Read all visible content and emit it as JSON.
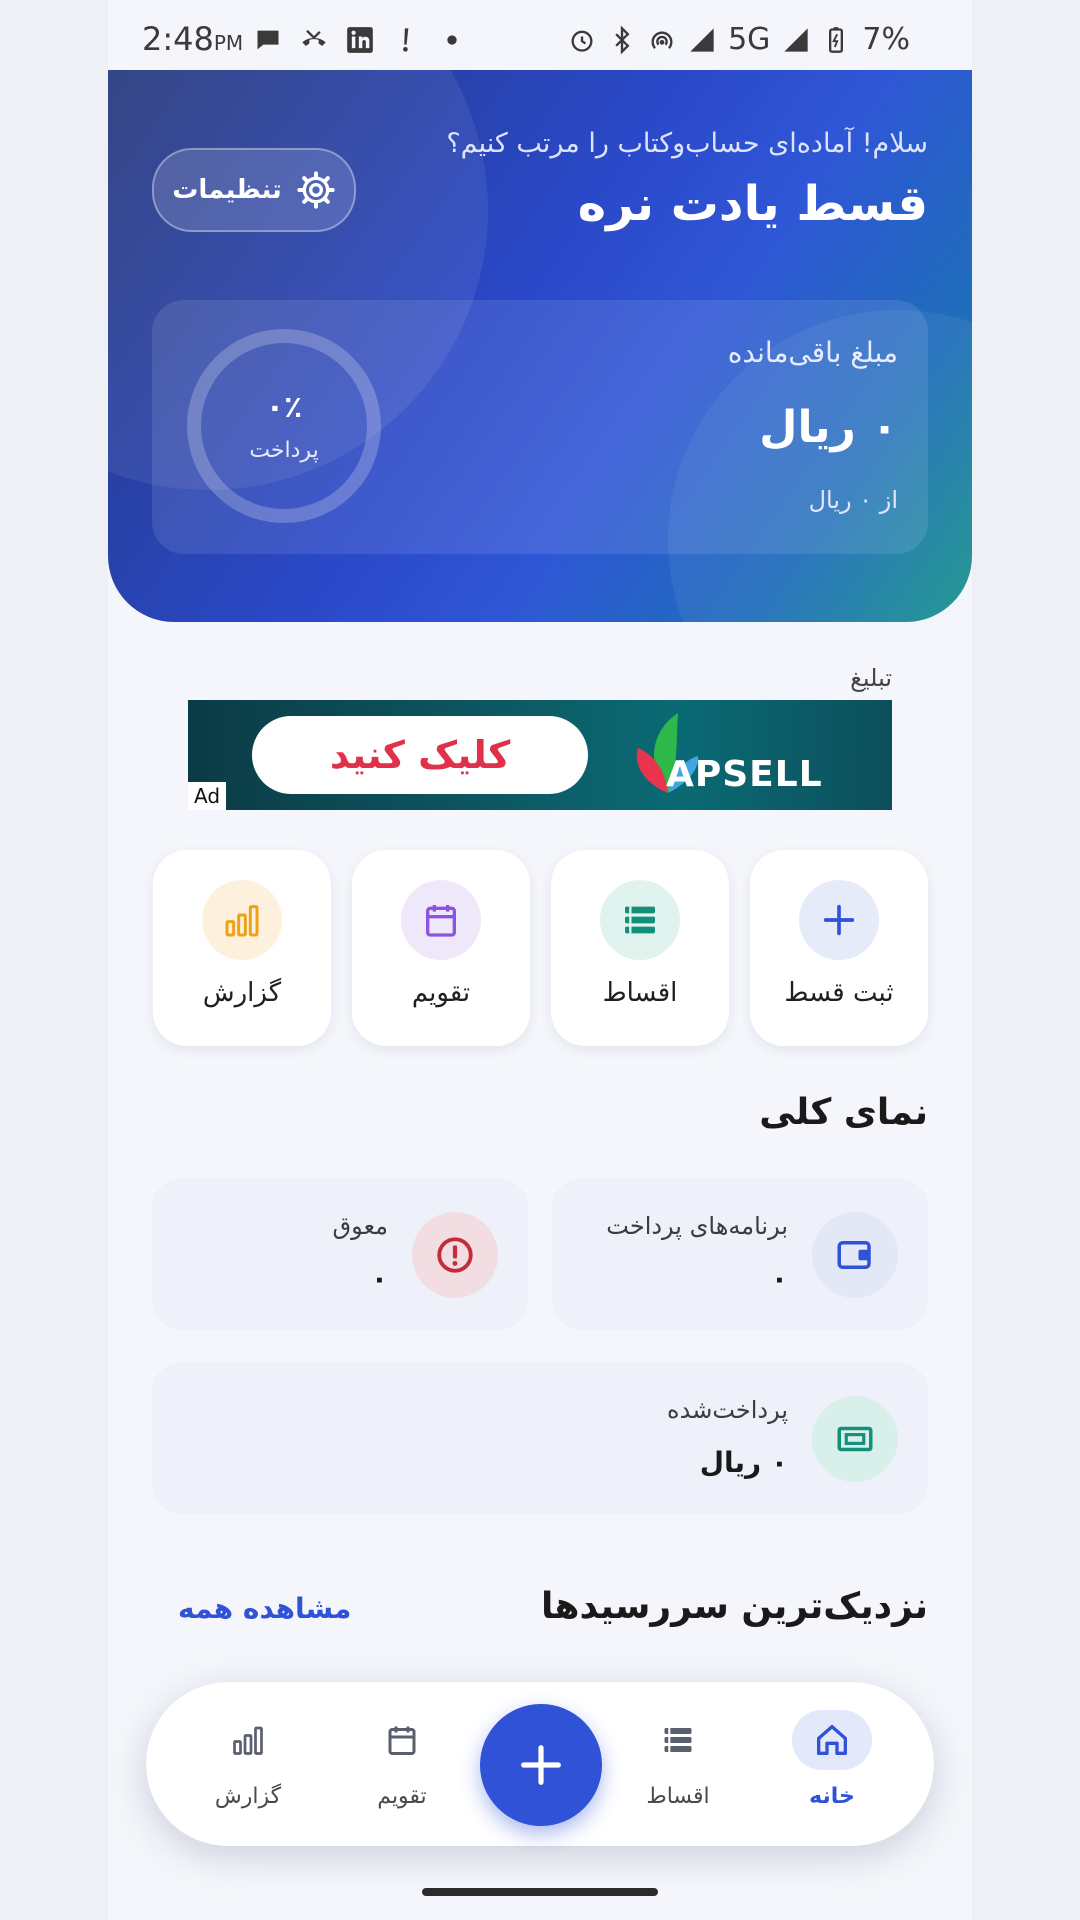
{
  "status_bar": {
    "time": "2:48",
    "ampm": "PM",
    "network": "5G",
    "battery": "7%"
  },
  "hero": {
    "greeting": "سلام! آماده‌ای حساب‌وکتاب را مرتب کنیم؟",
    "title": "قسط یادت نره",
    "settings_label": "تنظیمات",
    "balance_label": "مبلغ باقی‌مانده",
    "balance_amount": "۰ ریال",
    "balance_sub": "از ۰ ریال",
    "progress_percent": "۰٪",
    "progress_label": "پرداخت",
    "progress_value": 0
  },
  "ad": {
    "label": "تبلیغ",
    "cta": "کلیک کنید",
    "brand": "APSELL",
    "badge": "Ad"
  },
  "quick_actions": [
    {
      "label": "ثبت قسط",
      "icon": "plus-icon",
      "color": "#2f52d6",
      "bg": "#e6ebfa"
    },
    {
      "label": "اقساط",
      "icon": "list-icon",
      "color": "#14907a",
      "bg": "#e0f3ee"
    },
    {
      "label": "تقویم",
      "icon": "calendar-icon",
      "color": "#8a55e0",
      "bg": "#efe8fb"
    },
    {
      "label": "گزارش",
      "icon": "bar-chart-icon",
      "color": "#eea316",
      "bg": "#fdf1de"
    }
  ],
  "overview": {
    "title": "نمای کلی",
    "plans_label": "برنامه‌های پرداخت",
    "plans_value": "۰",
    "overdue_label": "معوق",
    "overdue_value": "۰",
    "paid_label": "پرداخت‌شده",
    "paid_value": "۰ ریال"
  },
  "upcoming": {
    "title": "نزدیک‌ترین سررسیدها",
    "see_all": "مشاهده همه"
  },
  "bottom_nav": {
    "home": "خانه",
    "installments": "اقساط",
    "calendar": "تقویم",
    "report": "گزارش",
    "active_color": "#2f52d6"
  }
}
